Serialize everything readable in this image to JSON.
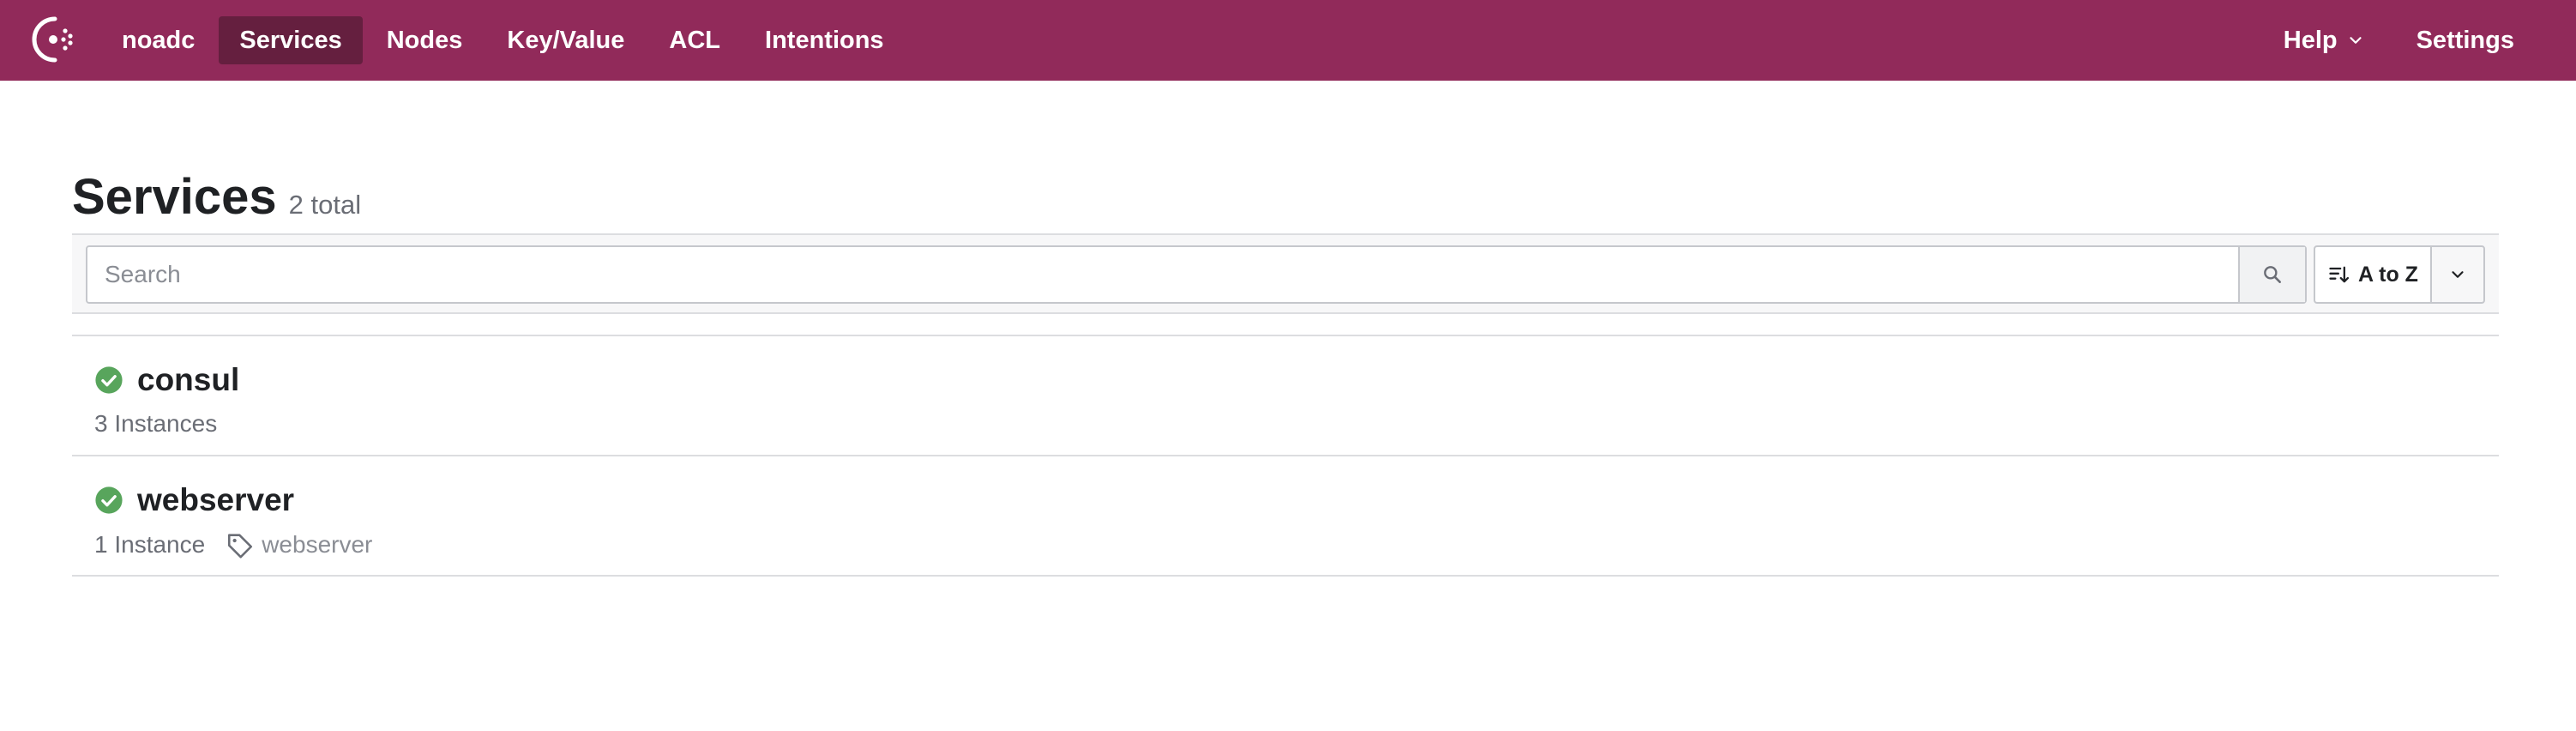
{
  "nav": {
    "datacenter": "noadc",
    "items": [
      {
        "label": "Services",
        "active": true
      },
      {
        "label": "Nodes",
        "active": false
      },
      {
        "label": "Key/Value",
        "active": false
      },
      {
        "label": "ACL",
        "active": false
      },
      {
        "label": "Intentions",
        "active": false
      }
    ],
    "help_label": "Help",
    "settings_label": "Settings"
  },
  "page": {
    "title": "Services",
    "total": "2 total"
  },
  "search": {
    "placeholder": "Search",
    "value": ""
  },
  "sort": {
    "label": "A to Z"
  },
  "services": [
    {
      "name": "consul",
      "status": "passing",
      "instances": "3 Instances",
      "tags": []
    },
    {
      "name": "webserver",
      "status": "passing",
      "instances": "1 Instance",
      "tags": [
        "webserver"
      ]
    }
  ],
  "colors": {
    "brand": "#912a5a",
    "brand_active": "#651f3f",
    "passing": "#58a55c"
  },
  "icons": {
    "logo": "consul-logo-icon",
    "search": "search-icon",
    "sort": "sort-icon",
    "status": "check-circle-icon",
    "tag": "tag-icon"
  }
}
